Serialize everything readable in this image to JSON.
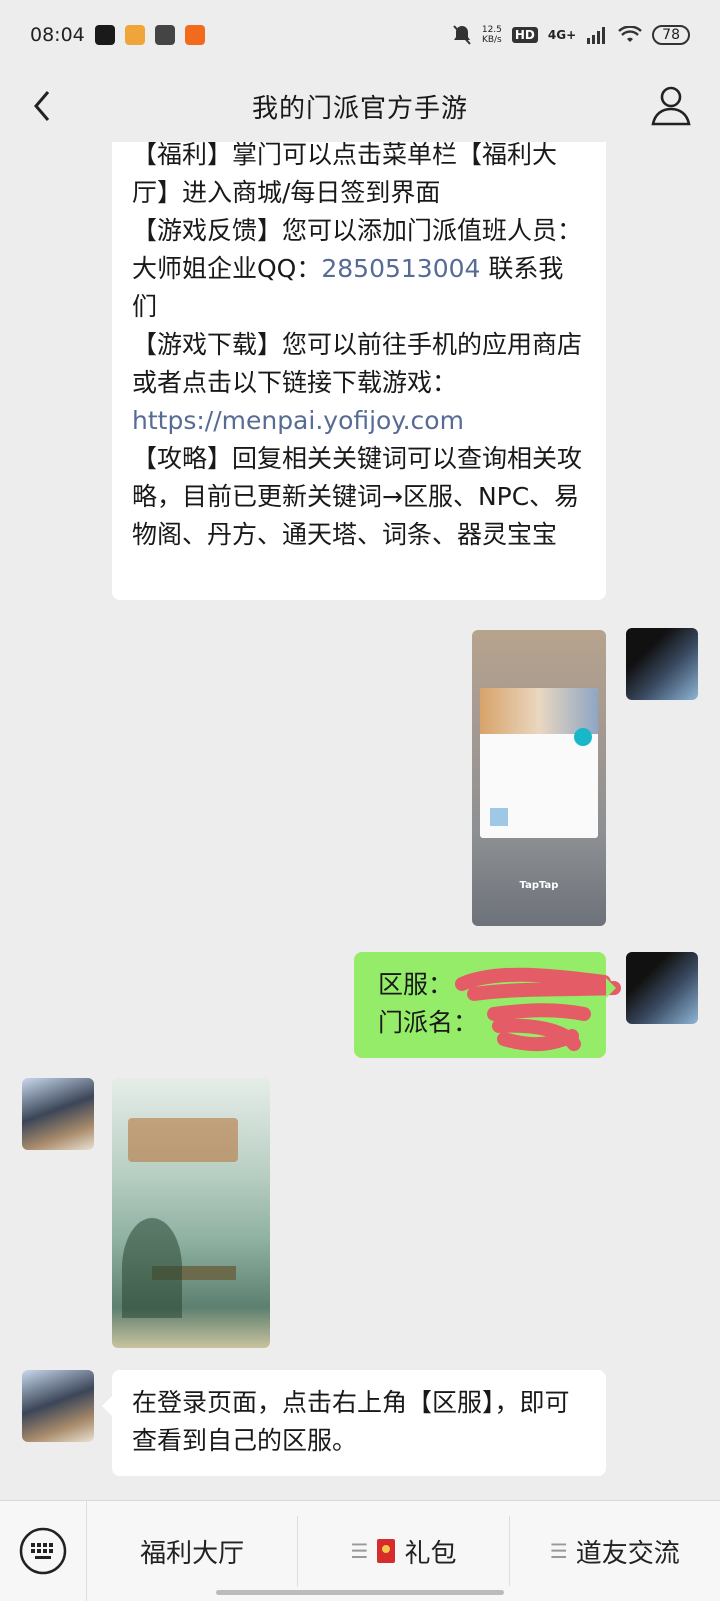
{
  "status_bar": {
    "time": "08:04",
    "net_speed_value": "12.5",
    "net_speed_unit": "KB/s",
    "hd": "HD",
    "network": "4G+",
    "battery": "78"
  },
  "nav": {
    "title": "我的门派官方手游"
  },
  "messages": {
    "info_text_1": "【福利】掌门可以点击菜单栏【福利大厅】进入商城/每日签到界面",
    "info_text_2a": "【游戏反馈】您可以添加门派值班人员：大师姐企业QQ：",
    "info_qq": "2850513004",
    "info_text_2b": " 联系我们",
    "info_text_3": "【游戏下载】您可以前往手机的应用商店或者点击以下链接下载游戏：",
    "info_link": "https://menpai.yofijoy.com",
    "info_text_4": "【攻略】回复相关关键词可以查询相关攻略，目前已更新关键词→区服、NPC、易物阁、丹方、通天塔、词条、器灵宝宝",
    "screenshot_label": "TapTap",
    "green_line_1": "区服：",
    "green_line_2": "门派名：",
    "reply_text": "在登录页面，点击右上角【区服】，即可查看到自己的区服。"
  },
  "menu": {
    "item_1": "福利大厅",
    "item_2": "礼包",
    "item_3": "道友交流"
  },
  "colors": {
    "link": "#576b95",
    "green_bubble": "#95ec69",
    "background": "#ededed"
  }
}
